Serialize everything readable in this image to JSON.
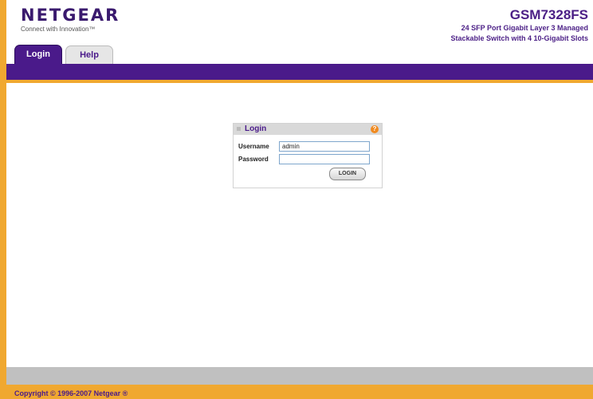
{
  "header": {
    "logo_text": "NETGEAR",
    "logo_tagline": "Connect with Innovation™",
    "model_name": "GSM7328FS",
    "model_desc_line1": "24 SFP Port Gigabit Layer 3 Managed",
    "model_desc_line2": "Stackable Switch with 4 10-Gigabit Slots"
  },
  "tabs": [
    {
      "label": "Login",
      "active": true
    },
    {
      "label": "Help",
      "active": false
    }
  ],
  "login": {
    "title": "Login",
    "help_icon": "help-icon",
    "username_label": "Username",
    "username_value": "admin",
    "password_label": "Password",
    "password_value": "",
    "button_label": "LOGIN"
  },
  "footer": {
    "copyright": "Copyright © 1996-2007 Netgear ®"
  },
  "colors": {
    "brand_purple": "#4a1a8a",
    "accent_orange": "#f0a830"
  }
}
